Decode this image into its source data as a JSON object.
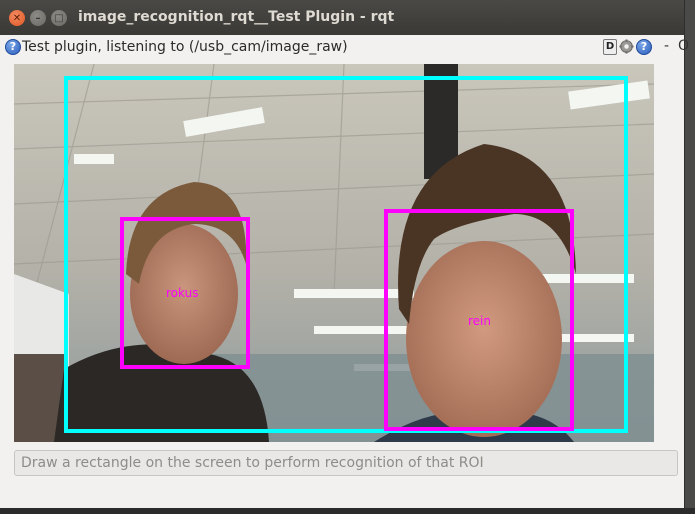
{
  "window": {
    "title": "image_recognition_rqt__Test Plugin - rqt"
  },
  "toolbar": {
    "plugin_label": "Test plugin, listening to (/usb_cam/image_raw)",
    "d_label": "D",
    "help_label": "?",
    "dash_label": "-",
    "o_label": "O"
  },
  "image_view": {
    "faces": [
      {
        "label": "rokus"
      },
      {
        "label": "rein"
      }
    ],
    "colors": {
      "roi_box": "#00ffff",
      "face_box": "#ff00ff",
      "face_label": "#ff00ff"
    }
  },
  "roi_field": {
    "placeholder": "Draw a rectangle on the screen to perform recognition of that ROI"
  },
  "icons": [
    "close-icon",
    "minimize-icon",
    "maximize-icon",
    "help-icon",
    "d-icon",
    "gear-icon"
  ]
}
